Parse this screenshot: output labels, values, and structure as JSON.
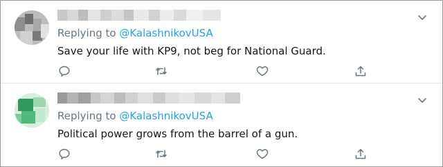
{
  "tweets": [
    {
      "replying_prefix": "Replying to ",
      "replying_handle": "@KalashnikovUSA",
      "text": "Save your life with KP9, not beg for National Guard.",
      "icons": [
        "reply-icon",
        "retweet-icon",
        "like-icon",
        "share-icon",
        "chevron-down-icon"
      ]
    },
    {
      "replying_prefix": "Replying to ",
      "replying_handle": "@KalashnikovUSA",
      "text": "Political power grows from the barrel of a gun.",
      "icons": [
        "reply-icon",
        "retweet-icon",
        "like-icon",
        "share-icon",
        "chevron-down-icon"
      ]
    }
  ],
  "colors": {
    "handle": "#1da1f2",
    "secondary_text": "#657786",
    "icon": "#657786",
    "separator": "#e1e8ed"
  }
}
